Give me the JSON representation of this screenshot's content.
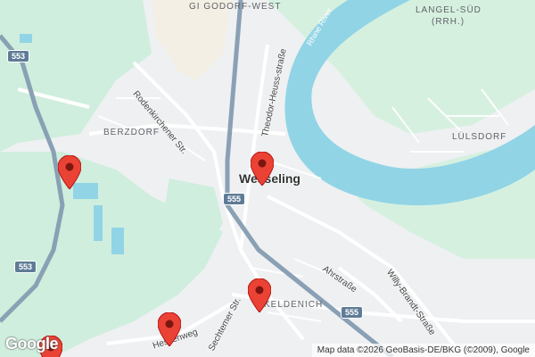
{
  "map": {
    "colors": {
      "land": "#eef0f2",
      "green": "#cfeedd",
      "water": "#91d4e6",
      "road": "#ffffff",
      "highway": "#8aa0b4",
      "marker": "#ea4335"
    },
    "places": [
      {
        "label": "GI GODORF-WEST"
      },
      {
        "label": "LANGEL-SÜD"
      },
      {
        "label": "(RRH.)"
      },
      {
        "label": "BERZDORF"
      },
      {
        "label": "LÜLSDORF"
      },
      {
        "label": "Wesseling"
      },
      {
        "label": "KELDENICH"
      }
    ],
    "streets": [
      {
        "label": "Rodenkirchener Str."
      },
      {
        "label": "Theodor-Heuss-straße"
      },
      {
        "label": "Ahrstraße"
      },
      {
        "label": "Willy-Brandt-Straße"
      },
      {
        "label": "Sechtemer Str."
      },
      {
        "label": "Hessenweg"
      }
    ],
    "water_label": "Rhine River",
    "shields": [
      "553",
      "555",
      "553",
      "555"
    ],
    "markers": [
      {
        "name": "marker-1"
      },
      {
        "name": "marker-2"
      },
      {
        "name": "marker-3"
      },
      {
        "name": "marker-4"
      },
      {
        "name": "marker-5"
      }
    ],
    "logo": "Google",
    "attribution": "Map data ©2026 GeoBasis-DE/BKG (©2009), Google"
  }
}
